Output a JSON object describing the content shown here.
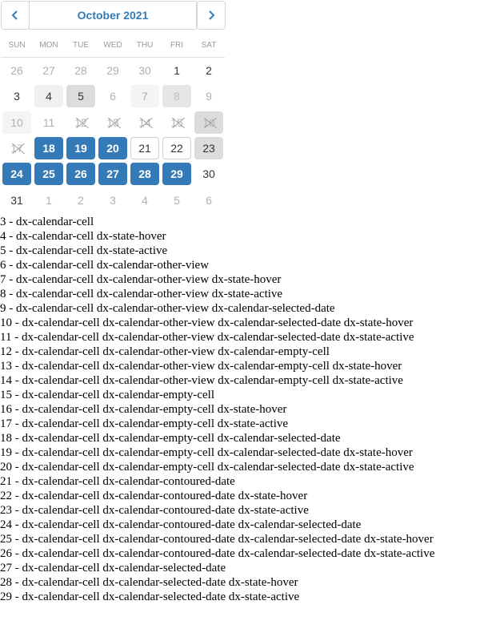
{
  "calendar": {
    "title": "October 2021",
    "prev_icon": "chevron-left-icon",
    "next_icon": "chevron-right-icon",
    "accent_color": "#337ab7",
    "weekdays": [
      "SUN",
      "MON",
      "TUE",
      "WED",
      "THU",
      "FRI",
      "SAT"
    ],
    "weeks": [
      [
        {
          "text": "26",
          "state": "other"
        },
        {
          "text": "27",
          "state": "other"
        },
        {
          "text": "28",
          "state": "other"
        },
        {
          "text": "29",
          "state": "other"
        },
        {
          "text": "30",
          "state": "other"
        },
        {
          "text": "1",
          "state": "normal"
        },
        {
          "text": "2",
          "state": "normal"
        }
      ],
      [
        {
          "text": "3",
          "state": "normal"
        },
        {
          "text": "4",
          "state": "hover"
        },
        {
          "text": "5",
          "state": "active"
        },
        {
          "text": "6",
          "state": "other"
        },
        {
          "text": "7",
          "state": "other-hover"
        },
        {
          "text": "8",
          "state": "other-active"
        },
        {
          "text": "9",
          "state": "other"
        }
      ],
      [
        {
          "text": "10",
          "state": "other-hover"
        },
        {
          "text": "11",
          "state": "other"
        },
        {
          "text": "12",
          "state": "empty"
        },
        {
          "text": "13",
          "state": "empty"
        },
        {
          "text": "14",
          "state": "empty"
        },
        {
          "text": "15",
          "state": "empty"
        },
        {
          "text": "16",
          "state": "empty-active"
        }
      ],
      [
        {
          "text": "17",
          "state": "empty"
        },
        {
          "text": "18",
          "state": "selected"
        },
        {
          "text": "19",
          "state": "selected"
        },
        {
          "text": "20",
          "state": "selected"
        },
        {
          "text": "21",
          "state": "contoured"
        },
        {
          "text": "22",
          "state": "contoured"
        },
        {
          "text": "23",
          "state": "active"
        }
      ],
      [
        {
          "text": "24",
          "state": "selected"
        },
        {
          "text": "25",
          "state": "selected"
        },
        {
          "text": "26",
          "state": "selected"
        },
        {
          "text": "27",
          "state": "selected"
        },
        {
          "text": "28",
          "state": "selected"
        },
        {
          "text": "29",
          "state": "selected"
        },
        {
          "text": "30",
          "state": "normal"
        }
      ],
      [
        {
          "text": "31",
          "state": "normal"
        },
        {
          "text": "1",
          "state": "other"
        },
        {
          "text": "2",
          "state": "other"
        },
        {
          "text": "3",
          "state": "other"
        },
        {
          "text": "4",
          "state": "other"
        },
        {
          "text": "5",
          "state": "other"
        },
        {
          "text": "6",
          "state": "other"
        }
      ]
    ]
  },
  "legend": [
    "3 - dx-calendar-cell",
    "4 - dx-calendar-cell dx-state-hover",
    "5 - dx-calendar-cell dx-state-active",
    "6 - dx-calendar-cell dx-calendar-other-view",
    "7 - dx-calendar-cell dx-calendar-other-view dx-state-hover",
    "8 - dx-calendar-cell dx-calendar-other-view dx-state-active",
    "9 - dx-calendar-cell dx-calendar-other-view dx-calendar-selected-date",
    "10 - dx-calendar-cell dx-calendar-other-view dx-calendar-selected-date dx-state-hover",
    "11 - dx-calendar-cell dx-calendar-other-view dx-calendar-selected-date dx-state-active",
    "12 - dx-calendar-cell dx-calendar-other-view dx-calendar-empty-cell",
    "13 - dx-calendar-cell dx-calendar-other-view dx-calendar-empty-cell dx-state-hover",
    "14 - dx-calendar-cell dx-calendar-other-view dx-calendar-empty-cell dx-state-active",
    "15 - dx-calendar-cell dx-calendar-empty-cell",
    "16 - dx-calendar-cell dx-calendar-empty-cell dx-state-hover",
    "17 - dx-calendar-cell dx-calendar-empty-cell dx-state-active",
    "18 - dx-calendar-cell dx-calendar-empty-cell dx-calendar-selected-date",
    "19 - dx-calendar-cell dx-calendar-empty-cell dx-calendar-selected-date dx-state-hover",
    "20 - dx-calendar-cell dx-calendar-empty-cell dx-calendar-selected-date dx-state-active",
    "21 - dx-calendar-cell dx-calendar-contoured-date",
    "22 - dx-calendar-cell dx-calendar-contoured-date dx-state-hover",
    "23 - dx-calendar-cell dx-calendar-contoured-date dx-state-active",
    "24 - dx-calendar-cell dx-calendar-contoured-date dx-calendar-selected-date",
    "25 - dx-calendar-cell dx-calendar-contoured-date dx-calendar-selected-date dx-state-hover",
    "26 - dx-calendar-cell dx-calendar-contoured-date dx-calendar-selected-date dx-state-active",
    "27 - dx-calendar-cell dx-calendar-selected-date",
    "28 - dx-calendar-cell dx-calendar-selected-date dx-state-hover",
    "29 - dx-calendar-cell dx-calendar-selected-date dx-state-active"
  ]
}
